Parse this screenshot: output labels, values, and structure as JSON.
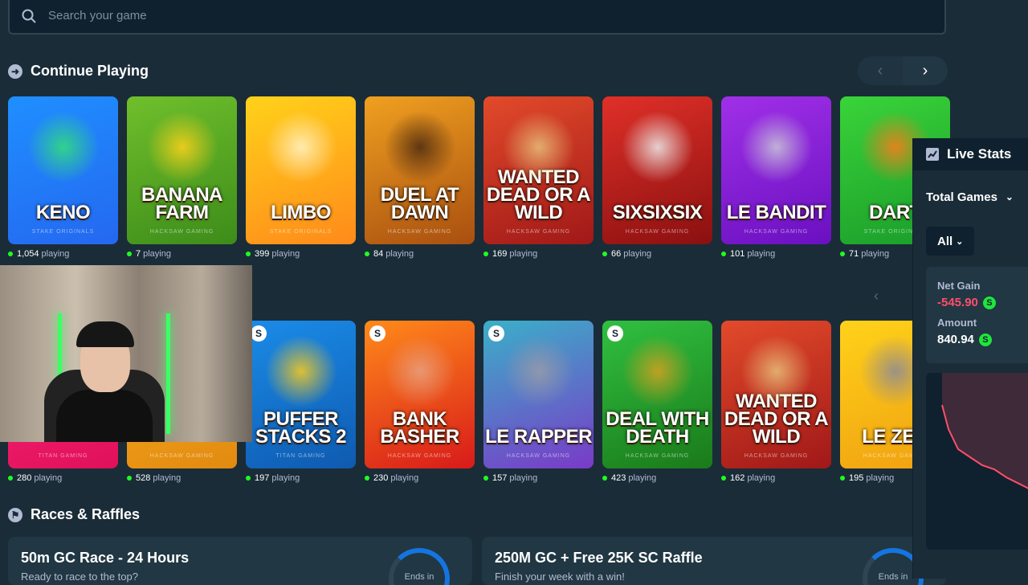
{
  "search": {
    "placeholder": "Search your game"
  },
  "continue_playing": {
    "title": "Continue Playing",
    "games": [
      {
        "name": "KENO",
        "studio": "STAKE ORIGINALS",
        "playing": "1,054",
        "bg": "#1f8fff",
        "bg2": "#2468f0",
        "accent": "#34e07a",
        "badge": false
      },
      {
        "name": "BANANA FARM",
        "studio": "HACKSAW GAMING",
        "playing": "7",
        "bg": "#6fbf2c",
        "bg2": "#3d8c1a",
        "accent": "#ffd21a",
        "badge": false
      },
      {
        "name": "LIMBO",
        "studio": "STAKE ORIGINALS",
        "playing": "399",
        "bg": "#ffd21a",
        "bg2": "#ff8a1a",
        "accent": "#fff4c8",
        "badge": false
      },
      {
        "name": "DUEL AT DAWN",
        "studio": "HACKSAW GAMING",
        "playing": "84",
        "bg": "#f0a020",
        "bg2": "#a84f10",
        "accent": "#4a2a10",
        "badge": false
      },
      {
        "name": "WANTED DEAD OR A WILD",
        "studio": "HACKSAW GAMING",
        "playing": "169",
        "bg": "#e24a2a",
        "bg2": "#a01818",
        "accent": "#e8c07a",
        "badge": false
      },
      {
        "name": "SIXSIXSIX",
        "studio": "HACKSAW GAMING",
        "playing": "66",
        "bg": "#e03028",
        "bg2": "#8a1010",
        "accent": "#ededed",
        "badge": false
      },
      {
        "name": "LE BANDIT",
        "studio": "HACKSAW GAMING",
        "playing": "101",
        "bg": "#a030e8",
        "bg2": "#6a10c0",
        "accent": "#c8c8d8",
        "badge": false
      },
      {
        "name": "DART",
        "studio": "STAKE ORIGINALS",
        "playing": "71",
        "bg": "#3ad43a",
        "bg2": "#1a9c2a",
        "accent": "#ff7a1a",
        "badge": false
      }
    ]
  },
  "second_row": {
    "games": [
      {
        "name": "",
        "studio": "TITAN GAMING",
        "playing": "280",
        "bg": "#ff2a7a",
        "bg2": "#e0105a",
        "accent": "#ff9ac0",
        "badge": false
      },
      {
        "name": "",
        "studio": "HACKSAW GAMING",
        "playing": "528",
        "bg": "#ffb020",
        "bg2": "#e08a10",
        "accent": "#ffe08a",
        "badge": false
      },
      {
        "name": "PUFFER STACKS 2",
        "studio": "TITAN GAMING",
        "playing": "197",
        "bg": "#1a8ce8",
        "bg2": "#0f5ab0",
        "accent": "#ffcc1a",
        "badge": true
      },
      {
        "name": "BANK BASHER",
        "studio": "HACKSAW GAMING",
        "playing": "230",
        "bg": "#ff8a1a",
        "bg2": "#d81a1a",
        "accent": "#e8a080",
        "badge": true
      },
      {
        "name": "LE RAPPER",
        "studio": "HACKSAW GAMING",
        "playing": "157",
        "bg": "#3ab0c8",
        "bg2": "#7a3ac8",
        "accent": "#9a9aa8",
        "badge": true
      },
      {
        "name": "DEAL WITH DEATH",
        "studio": "HACKSAW GAMING",
        "playing": "423",
        "bg": "#30c040",
        "bg2": "#1a7a1a",
        "accent": "#d8a020",
        "badge": true
      },
      {
        "name": "WANTED DEAD OR A WILD",
        "studio": "HACKSAW GAMING",
        "playing": "162",
        "bg": "#e24a2a",
        "bg2": "#a01818",
        "accent": "#e8c07a",
        "badge": false
      },
      {
        "name": "LE ZEU",
        "studio": "HACKSAW GAMING",
        "playing": "195",
        "bg": "#ffd21a",
        "bg2": "#f0a010",
        "accent": "#8a8a98",
        "badge": false
      }
    ]
  },
  "playing_suffix": "playing",
  "races": {
    "title": "Races & Raffles",
    "items": [
      {
        "title": "50m GC Race - 24 Hours",
        "subtitle": "Ready to race to the top?",
        "ring_label": "Ends in"
      },
      {
        "title": "250M GC + Free 25K SC Raffle",
        "subtitle": "Finish your week with a win!",
        "ring_label": "Ends in"
      }
    ]
  },
  "live_stats": {
    "title": "Live Stats",
    "dropdown": "Total Games",
    "filter": "All",
    "net_gain_label": "Net Gain",
    "net_gain_value": "-545.90",
    "amount_label": "Amount",
    "amount_value": "840.94",
    "coin_symbol": "S",
    "colors": {
      "negative": "#ff4e6a",
      "coin": "#1fe43d"
    }
  },
  "nav": {
    "prev": "‹",
    "next": "›"
  },
  "badge_symbol": "S",
  "colors": {
    "bg": "#1a2c38",
    "panel": "#213743",
    "dark": "#0f212e",
    "accent_blue": "#1475e1",
    "online": "#1fff20"
  }
}
